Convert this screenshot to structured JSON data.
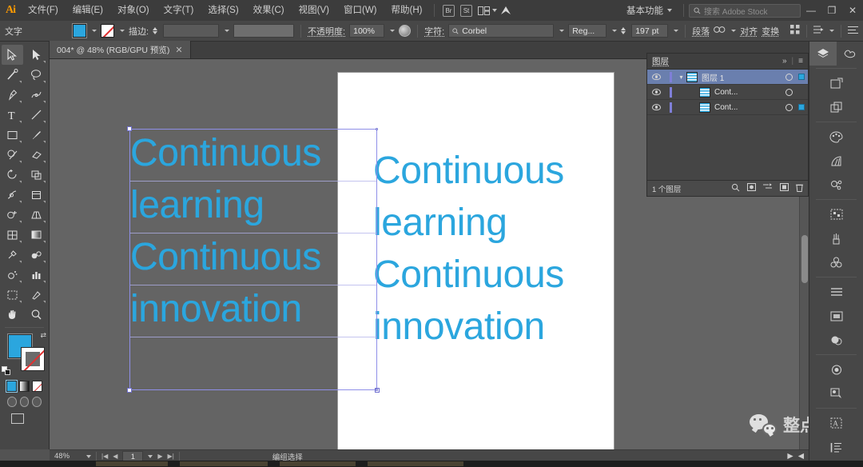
{
  "app": {
    "name": "Adobe Illustrator",
    "logo_text": "Ai"
  },
  "menubar": {
    "items": [
      "文件(F)",
      "编辑(E)",
      "对象(O)",
      "文字(T)",
      "选择(S)",
      "效果(C)",
      "视图(V)",
      "窗口(W)",
      "帮助(H)"
    ],
    "bridge_label": "Br",
    "stock_label": "St",
    "arrange_label": "▦",
    "workspace": "基本功能",
    "search_placeholder": "搜索 Adobe Stock",
    "window_buttons": {
      "minimize": "—",
      "restore": "❐",
      "close": "✕"
    }
  },
  "controlbar": {
    "tool_label": "文字",
    "fill_color": "#2ba6de",
    "stroke_label": "描边:",
    "stroke_weight": "",
    "opacity_label": "不透明度:",
    "opacity_value": "100%",
    "character_label": "字符:",
    "font_family": "Corbel",
    "font_style": "Reg...",
    "font_size": "197",
    "font_size_unit": "pt",
    "paragraph_label": "段落",
    "align_label": "对齐",
    "transform_label": "变换"
  },
  "document": {
    "tab_title": "004* @ 48% (RGB/GPU 预览)",
    "close_glyph": "✕"
  },
  "toolbar": {
    "tools": [
      "selection-tool",
      "direct-selection-tool",
      "magic-wand-tool",
      "lasso-tool",
      "pen-tool",
      "curvature-tool",
      "type-tool",
      "line-segment-tool",
      "rectangle-tool",
      "paintbrush-tool",
      "shaper-tool",
      "eraser-tool",
      "rotate-tool",
      "scale-tool",
      "width-tool",
      "free-transform-tool",
      "shape-builder-tool",
      "perspective-grid-tool",
      "mesh-tool",
      "gradient-tool",
      "eyedropper-tool",
      "blend-tool",
      "symbol-sprayer-tool",
      "column-graph-tool",
      "artboard-tool",
      "slice-tool",
      "hand-tool",
      "zoom-tool"
    ],
    "fill_color": "#2ba6de",
    "stroke_color": "none"
  },
  "canvas": {
    "artboard_text": "Continuous learning Continuous innovation",
    "artboard_lines": [
      "Continuous",
      " learning",
      "Continuous",
      " innovation"
    ],
    "selected_text_lines": [
      "Continuous",
      " learning",
      "Continuous",
      " innovation"
    ],
    "text_color": "#2ba6de",
    "selection_color": "#8f8fe8"
  },
  "layers_panel": {
    "title": "图层",
    "collapse_glyph": "»",
    "menu_glyph": "≡",
    "rows": [
      {
        "name": "图层 1",
        "selected": true,
        "expanded": true,
        "has_selection_square": true
      },
      {
        "name": "Cont...",
        "selected": false,
        "expanded": false,
        "has_selection_square": false
      },
      {
        "name": "Cont...",
        "selected": false,
        "expanded": false,
        "has_selection_square": true
      }
    ],
    "footer_count": "1 个图层",
    "footer_icons": [
      "locate-object-icon",
      "make-mask-icon",
      "create-sublayer-icon",
      "new-layer-icon",
      "delete-layer-icon"
    ]
  },
  "right_dock": {
    "items": [
      "layers-panel-icon",
      "libraries-panel-icon",
      "artboards-panel-icon",
      "asset-export-panel-icon",
      "color-panel-icon",
      "color-guide-panel-icon",
      "pathfinder-panel-icon",
      "image-trace-panel-icon",
      "brushes-panel-icon",
      "symbols-panel-icon",
      "align-panel-icon",
      "transform-panel-icon",
      "appearance-panel-icon",
      "graphic-styles-panel-icon",
      "transparency-panel-icon",
      "gradient-panel-icon",
      "stroke-panel-icon",
      "character-panel-icon",
      "paragraph-panel-icon"
    ]
  },
  "statusbar": {
    "zoom": "48%",
    "page": "1",
    "status_text": "编组选择",
    "nav_first": "|◀",
    "nav_prev": "◀",
    "nav_next": "▶",
    "nav_last": "▶|",
    "play_glyph": "▶",
    "more_glyph": "◀"
  },
  "watermark": {
    "text": "整点创作",
    "icon": "wechat-icon"
  }
}
